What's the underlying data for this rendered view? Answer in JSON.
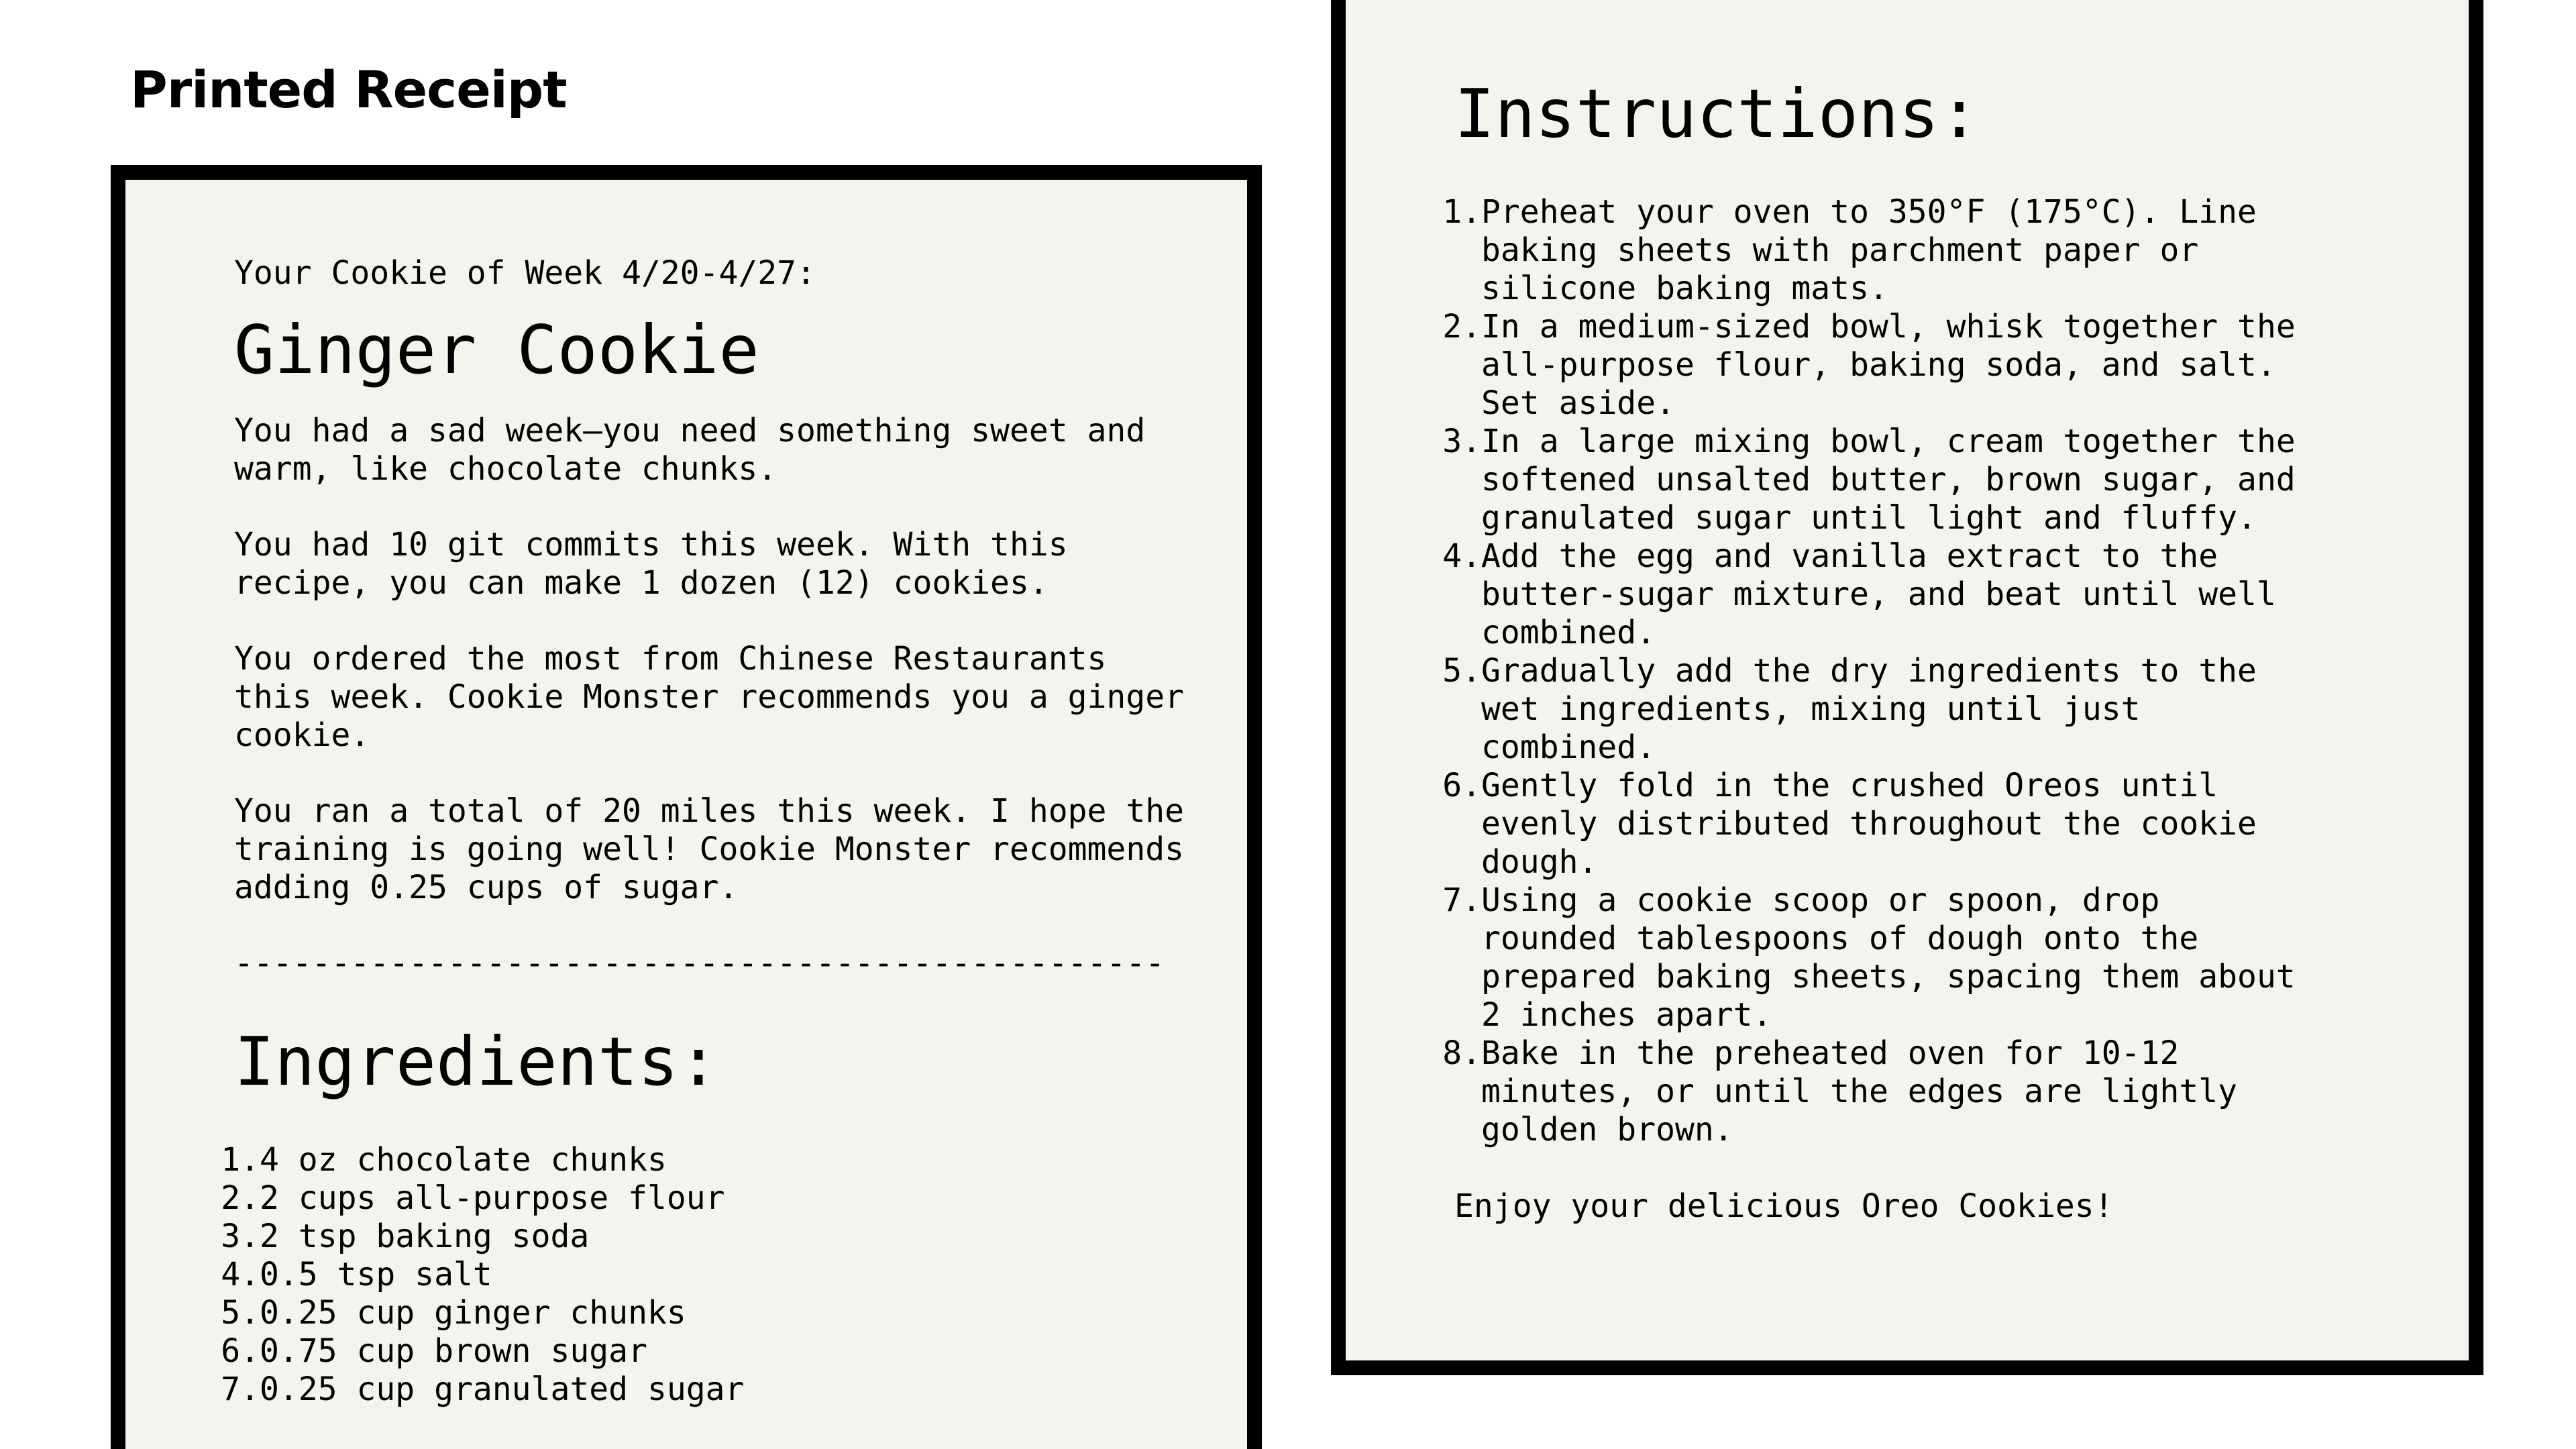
{
  "page": {
    "title": "Printed Receipt"
  },
  "left_receipt": {
    "intro": "Your Cookie of Week 4/20-4/27:",
    "cookie_name": "Ginger Cookie",
    "paragraphs": [
      "You had a sad week—you need something sweet and warm, like chocolate chunks.",
      "You had 10 git commits this week. With this recipe, you can make 1 dozen (12) cookies.",
      "You ordered the most from Chinese Restaurants this week. Cookie Monster recommends you a ginger cookie.",
      "You ran a total of 20 miles this week. I hope the training is going well! Cookie Monster recommends adding 0.25 cups of sugar."
    ],
    "divider": "------------------------------------------------",
    "ingredients_heading": "Ingredients:",
    "ingredients": [
      {
        "num": "1.",
        "text": "4 oz chocolate chunks"
      },
      {
        "num": "2.",
        "text": "2 cups all-purpose flour"
      },
      {
        "num": "3.",
        "text": "2 tsp baking soda"
      },
      {
        "num": "4.",
        "text": "0.5 tsp salt"
      },
      {
        "num": "5.",
        "text": "0.25 cup ginger chunks"
      },
      {
        "num": "6.",
        "text": "0.75 cup brown sugar"
      },
      {
        "num": "7.",
        "text": "0.25 cup granulated sugar"
      }
    ]
  },
  "right_receipt": {
    "instructions_heading": "Instructions:",
    "instructions": [
      {
        "num": "1.",
        "text": "Preheat your oven to 350°F (175°C). Line baking sheets with parchment paper or silicone baking mats."
      },
      {
        "num": "2.",
        "text": "In a medium-sized bowl, whisk together the all-purpose flour, baking soda, and salt. Set aside."
      },
      {
        "num": "3.",
        "text": "In a large mixing bowl, cream together the softened unsalted butter, brown sugar, and granulated sugar until light and fluffy."
      },
      {
        "num": "4.",
        "text": "Add the egg and vanilla extract to the butter-sugar mixture, and beat until well combined."
      },
      {
        "num": "5.",
        "text": "Gradually add the dry ingredients to the wet ingredients, mixing until just combined."
      },
      {
        "num": "6.",
        "text": "Gently fold in the crushed Oreos until evenly distributed throughout the cookie dough."
      },
      {
        "num": "7.",
        "text": "Using a cookie scoop or spoon, drop rounded tablespoons of dough onto the prepared baking sheets, spacing them about 2 inches apart."
      },
      {
        "num": "8.",
        "text": "Bake in the preheated oven for 10-12 minutes, or until the edges are lightly golden brown."
      }
    ],
    "closing": "Enjoy your delicious Oreo Cookies!"
  },
  "colors": {
    "receipt_background": "#f4f4ef",
    "border": "#000000",
    "text": "#000000"
  }
}
